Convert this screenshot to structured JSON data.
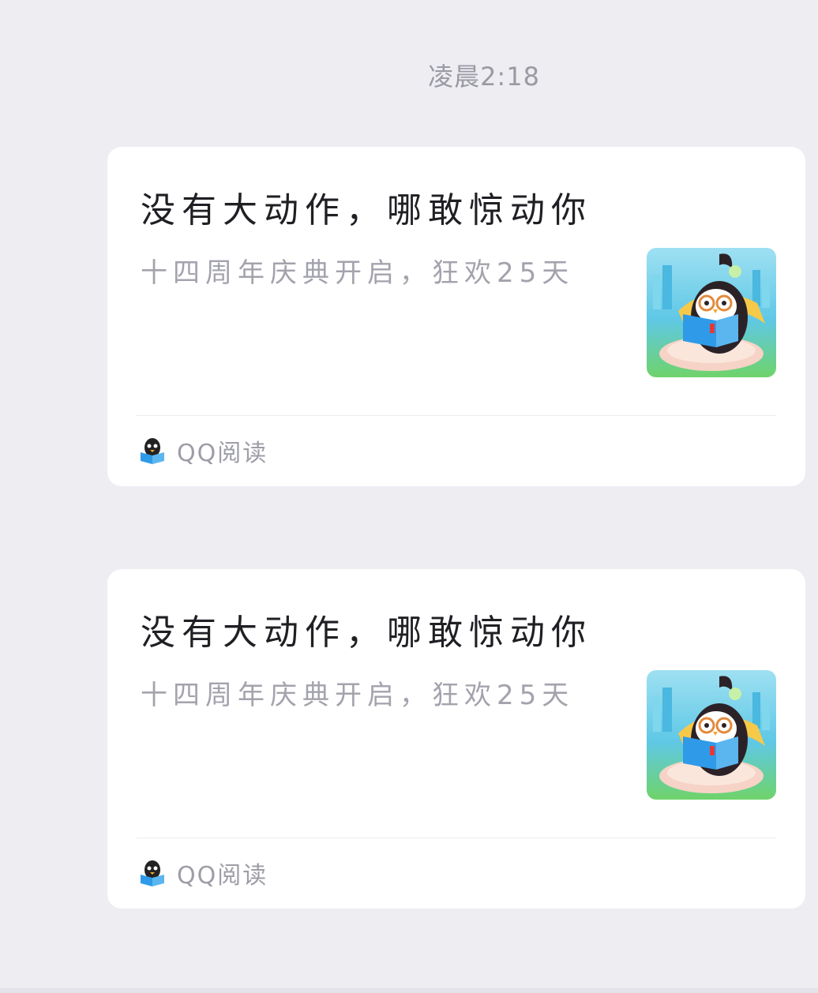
{
  "timestamp": "凌晨2:18",
  "messages": [
    {
      "title": "没有大动作，哪敢惊动你",
      "subtitle": "十四周年庆典开启，狂欢25天",
      "thumbnail_icon": "penguin-reading-icon",
      "source": {
        "name": "QQ阅读",
        "icon": "qq-reading-penguin-icon"
      }
    },
    {
      "title": "没有大动作，哪敢惊动你",
      "subtitle": "十四周年庆典开启，狂欢25天",
      "thumbnail_icon": "penguin-reading-icon",
      "source": {
        "name": "QQ阅读",
        "icon": "qq-reading-penguin-icon"
      }
    }
  ],
  "colors": {
    "background": "#ededf2",
    "card": "#ffffff",
    "title": "#1f1f24",
    "subtitle": "#a3a3ad",
    "book_blue": "#2f9be8"
  }
}
